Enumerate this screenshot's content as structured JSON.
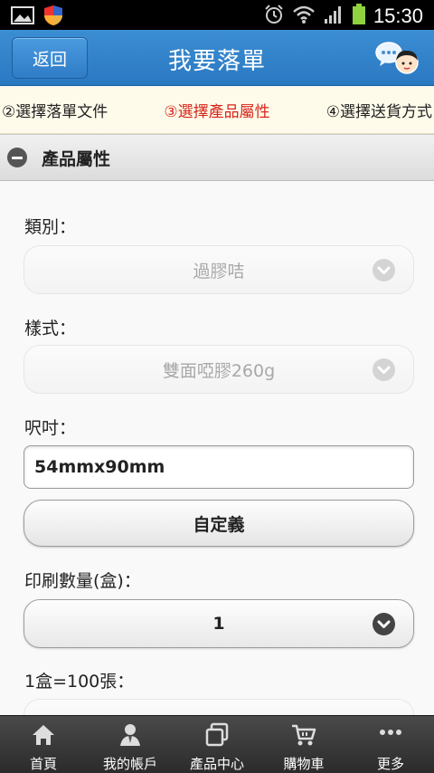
{
  "status_bar": {
    "time": "15:30",
    "icons": [
      "image-icon",
      "shield-icon",
      "alarm-icon",
      "wifi-icon",
      "signal-icon",
      "battery-icon"
    ]
  },
  "header": {
    "back_label": "返回",
    "title": "我要落單",
    "chat_icon": "chat-avatar-icon"
  },
  "steps": [
    {
      "label": "②選擇落單文件",
      "active": false
    },
    {
      "label": "③選擇產品屬性",
      "active": true
    },
    {
      "label": "④選擇送貨方式",
      "active": false
    }
  ],
  "section": {
    "title": "產品屬性"
  },
  "form": {
    "category_label": "類別：",
    "category_value": "過膠咭",
    "style_label": "樣式：",
    "style_value": "雙面啞膠260g",
    "size_label": "呎吋：",
    "size_value": "54mmx90mm",
    "custom_button": "自定義",
    "quantity_label": "印刷數量(盒)：",
    "quantity_value": "1",
    "box_note_label": "1盒=100張："
  },
  "bottom_nav": [
    {
      "label": "首頁",
      "icon": "home-icon"
    },
    {
      "label": "我的帳戶",
      "icon": "user-icon"
    },
    {
      "label": "產品中心",
      "icon": "product-icon"
    },
    {
      "label": "購物車",
      "icon": "cart-icon"
    },
    {
      "label": "更多",
      "icon": "more-icon"
    }
  ],
  "colors": {
    "header_blue": "#2a78c2",
    "active_step": "#d9261c",
    "steps_bg": "#fffbea"
  }
}
